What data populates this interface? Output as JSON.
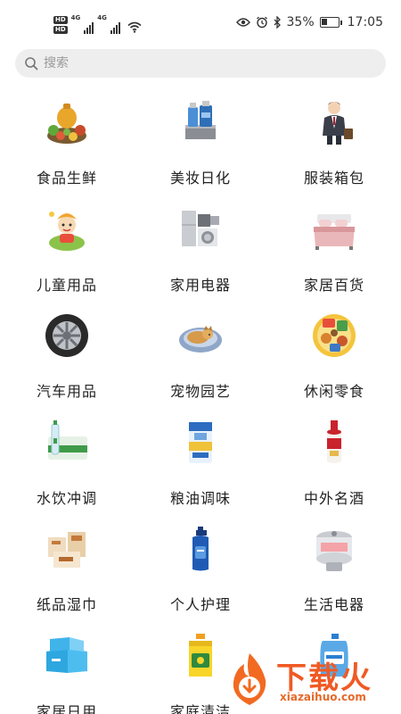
{
  "status_bar": {
    "hd_top": "HD",
    "hd_bottom": "HD",
    "net_1": "4G",
    "net_2": "4G",
    "battery_percent": "35%",
    "time": "17:05"
  },
  "search": {
    "placeholder": "搜索"
  },
  "categories": [
    {
      "label": "食品生鲜",
      "icon": "food-icon"
    },
    {
      "label": "美妆日化",
      "icon": "cosmetics-icon"
    },
    {
      "label": "服装箱包",
      "icon": "clothing-icon"
    },
    {
      "label": "儿童用品",
      "icon": "kids-icon"
    },
    {
      "label": "家用电器",
      "icon": "appliance-icon"
    },
    {
      "label": "家居百货",
      "icon": "home-goods-icon"
    },
    {
      "label": "汽车用品",
      "icon": "car-tire-icon"
    },
    {
      "label": "宠物园艺",
      "icon": "pet-icon"
    },
    {
      "label": "休闲零食",
      "icon": "snacks-icon"
    },
    {
      "label": "水饮冲调",
      "icon": "water-icon"
    },
    {
      "label": "粮油调味",
      "icon": "rice-icon"
    },
    {
      "label": "中外名酒",
      "icon": "liquor-icon"
    },
    {
      "label": "纸品湿巾",
      "icon": "paper-icon"
    },
    {
      "label": "个人护理",
      "icon": "shampoo-icon"
    },
    {
      "label": "生活电器",
      "icon": "cooker-icon"
    },
    {
      "label": "家居日用",
      "icon": "storage-box-icon"
    },
    {
      "label": "家庭清洁",
      "icon": "detergent-icon"
    },
    {
      "label": "",
      "icon": "laundry-liquid-icon"
    }
  ],
  "watermark": {
    "text": "下载火",
    "url": "xiazaihuo.com"
  },
  "colors": {
    "search_bg": "#eeeeee",
    "watermark_orange": "#f05a24"
  }
}
